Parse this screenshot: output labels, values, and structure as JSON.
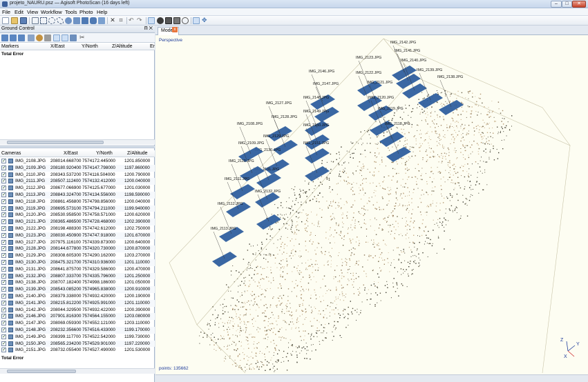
{
  "window": {
    "title": "projeto_NAURU.psz — Agisoft PhotoScan (16 days left)",
    "min": "–",
    "max": "□",
    "close": "✕"
  },
  "menu": [
    "File",
    "Edit",
    "View",
    "Workflow",
    "Tools",
    "Photo",
    "Help"
  ],
  "ground_control": {
    "title": "Ground Control",
    "pin": "ᗰ ✕",
    "columns": [
      "Markers",
      "X/East",
      "Y/North",
      "Z/Altitude",
      "Er"
    ],
    "total_error": "Total Error"
  },
  "cameras": {
    "columns": [
      "Cameras",
      "X/East",
      "Y/North",
      "Z/Altitude"
    ],
    "rows": [
      [
        "IMG_2108.JPG",
        "208014.668700",
        "7574172.445000",
        "1201.850000"
      ],
      [
        "IMG_2109.JPG",
        "208180.920400",
        "7574147.798000",
        "1197.860000"
      ],
      [
        "IMG_2110.JPG",
        "208343.537200",
        "7574116.504000",
        "1200.790000"
      ],
      [
        "IMG_2111.JPG",
        "208507.112400",
        "7574132.412000",
        "1200.040000"
      ],
      [
        "IMG_2112.JPG",
        "208677.066900",
        "7574125.677000",
        "1201.030000"
      ],
      [
        "IMG_2113.JPG",
        "208843.324700",
        "7574134.556000",
        "1198.590000"
      ],
      [
        "IMG_2118.JPG",
        "208861.456800",
        "7574798.856000",
        "1200.040000"
      ],
      [
        "IMG_2119.JPG",
        "208695.573100",
        "7574794.211000",
        "1199.940000"
      ],
      [
        "IMG_2120.JPG",
        "208530.958500",
        "7574758.571000",
        "1200.620000"
      ],
      [
        "IMG_2121.JPG",
        "208365.486500",
        "7574728.468000",
        "1202.390000"
      ],
      [
        "IMG_2122.JPG",
        "208198.488300",
        "7574742.612000",
        "1202.750000"
      ],
      [
        "IMG_2123.JPG",
        "208030.450900",
        "7574747.918000",
        "1201.670000"
      ],
      [
        "IMG_2127.JPG",
        "207975.116100",
        "7574339.873000",
        "1200.640000"
      ],
      [
        "IMG_2128.JPG",
        "208144.677800",
        "7574320.730000",
        "1200.870000"
      ],
      [
        "IMG_2129.JPG",
        "208308.605300",
        "7574290.162000",
        "1203.270000"
      ],
      [
        "IMG_2130.JPG",
        "208475.321700",
        "7574310.936000",
        "1201.110000"
      ],
      [
        "IMG_2131.JPG",
        "208641.875700",
        "7574329.586000",
        "1200.470000"
      ],
      [
        "IMG_2132.JPG",
        "208807.333700",
        "7574335.796000",
        "1201.250000"
      ],
      [
        "IMG_2138.JPG",
        "208707.182400",
        "7574998.186000",
        "1201.050000"
      ],
      [
        "IMG_2139.JPG",
        "208543.085200",
        "7574965.838000",
        "1200.910000"
      ],
      [
        "IMG_2140.JPG",
        "208379.338000",
        "7574932.420000",
        "1200.190000"
      ],
      [
        "IMG_2141.JPG",
        "208215.812200",
        "7574925.991000",
        "1201.110000"
      ],
      [
        "IMG_2142.JPG",
        "208044.329500",
        "7574932.422000",
        "1200.390000"
      ],
      [
        "IMG_2146.JPG",
        "207901.816300",
        "7574564.155000",
        "1203.080000"
      ],
      [
        "IMG_2147.JPG",
        "208069.059300",
        "7574552.121000",
        "1203.110000"
      ],
      [
        "IMG_2148.JPG",
        "208232.356600",
        "7574516.433000",
        "1199.170000"
      ],
      [
        "IMG_2149.JPG",
        "208399.117700",
        "7574522.542000",
        "1199.730000"
      ],
      [
        "IMG_2150.JPG",
        "208565.234200",
        "7574529.901000",
        "1197.220000"
      ],
      [
        "IMG_2151.JPG",
        "208732.055400",
        "7574527.490000",
        "1201.530000"
      ]
    ],
    "total_error": "Total Error"
  },
  "viewport": {
    "tab": "Model",
    "tab_close": "x",
    "mode": "Perspective",
    "points": "points: 135662",
    "axes": {
      "z": "Z",
      "y": "Y",
      "x": "X"
    },
    "camera_labels": [
      "IMG_2142.JPG",
      "IMG_2141.JPG",
      "IMG_2140.JPG",
      "IMG_2139.JPG",
      "IMG_2138.JPG",
      "IMG_2123.JPG",
      "IMG_2122.JPG",
      "IMG_2121.JPG",
      "IMG_2120.JPG",
      "IMG_2119.JPG",
      "IMG_2118.JPG",
      "IMG_2146.JPG",
      "IMG_2147.JPG",
      "IMG_2148.JPG",
      "IMG_2149.JPG",
      "IMG_2150.JPG",
      "IMG_2151.JPG",
      "IMG_2127.JPG",
      "IMG_2128.JPG",
      "IMG_2129.JPG",
      "IMG_2130.JPG",
      "IMG_2131.JPG",
      "IMG_2132.JPG",
      "IMG_2108.JPG",
      "IMG_2109.JPG",
      "IMG_2110.JPG",
      "IMG_2111.JPG",
      "IMG_2112.JPG",
      "IMG_2113.JPG"
    ]
  },
  "colors": {
    "camera_plane": "#2f5f9e",
    "viewport_bg": "#fdfdf2",
    "points_dark": "#3a3a2c",
    "points_light": "#b89a74"
  }
}
